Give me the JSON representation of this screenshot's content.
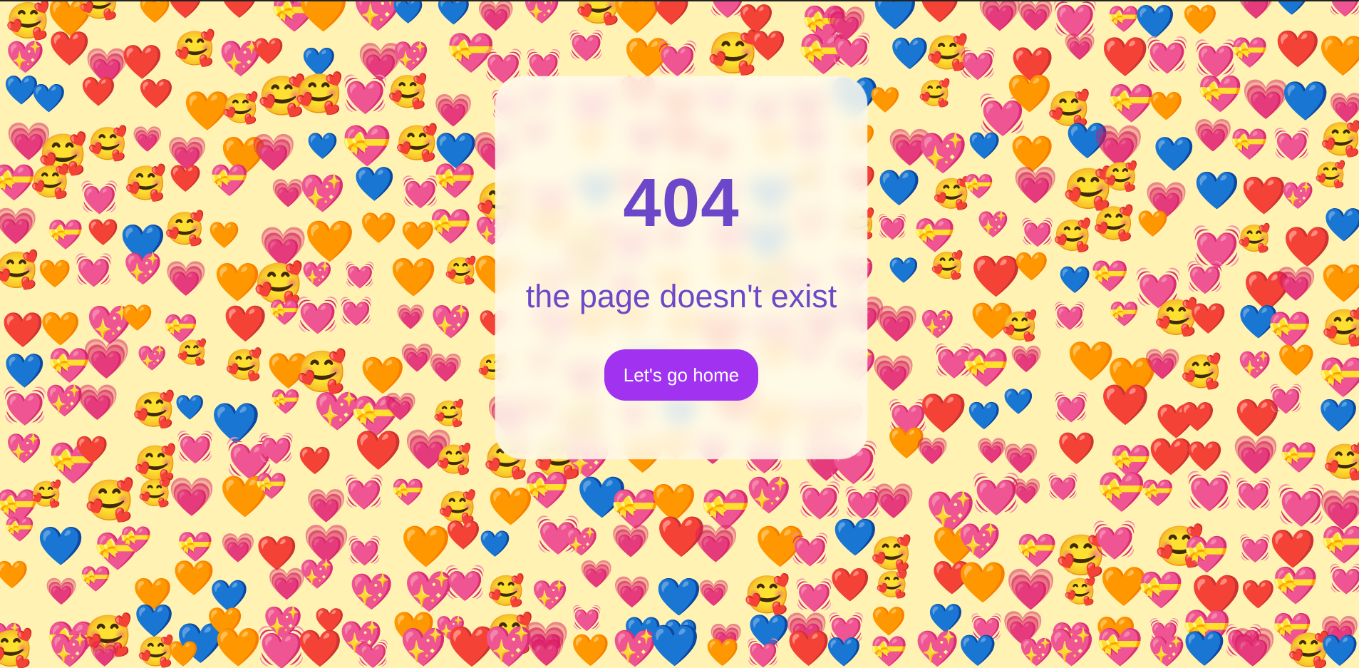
{
  "error_code": "404",
  "message": "the page doesn't exist",
  "home_button_label": "Let's go home",
  "colors": {
    "background": "#fff2b3",
    "accent": "#6c47c9",
    "button": "#a032f0"
  },
  "background_icons": [
    "smiling-face-with-hearts",
    "red-heart",
    "blue-heart",
    "orange-heart",
    "pink-heart",
    "sparkling-heart",
    "heart-with-ribbon",
    "beating-heart"
  ]
}
